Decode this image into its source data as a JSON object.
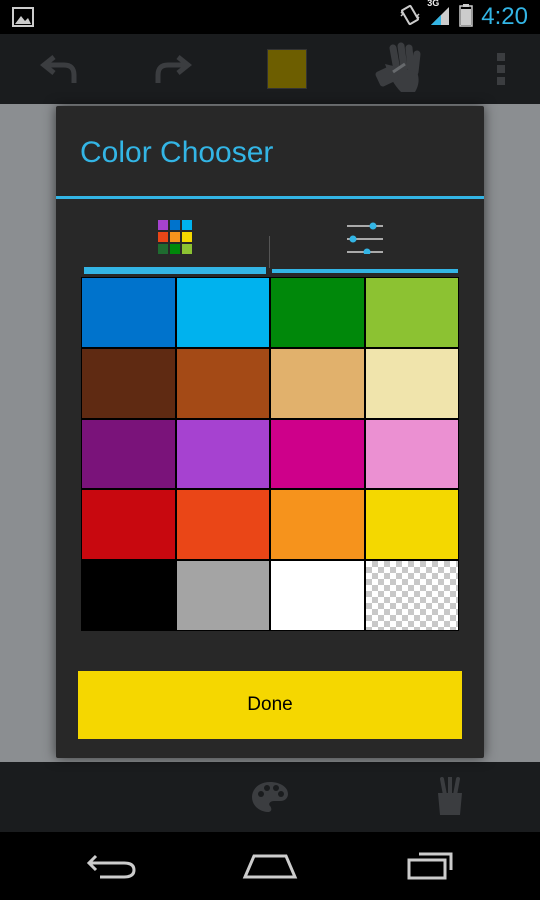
{
  "status_bar": {
    "time": "4:20",
    "network": "3G",
    "icons": [
      "gallery-icon",
      "vibrate-icon",
      "signal-icon",
      "battery-icon"
    ]
  },
  "action_bar": {
    "icons": [
      "undo-icon",
      "redo-icon",
      "current-color-icon",
      "paint-bucket-icon",
      "overflow-menu-icon"
    ],
    "current_color": "#6d5e00"
  },
  "dialog": {
    "title": "Color Chooser",
    "tabs": [
      {
        "icon": "palette-grid-icon",
        "active": true
      },
      {
        "icon": "sliders-icon",
        "active": false
      }
    ],
    "swatches": [
      {
        "color": "#0073cc"
      },
      {
        "color": "#00b2ee"
      },
      {
        "color": "#00880a"
      },
      {
        "color": "#8cc232"
      },
      {
        "color": "#5f2a12"
      },
      {
        "color": "#a44a16"
      },
      {
        "color": "#e1b16c"
      },
      {
        "color": "#f0e4ac"
      },
      {
        "color": "#7a137a"
      },
      {
        "color": "#a642d0"
      },
      {
        "color": "#ce008a"
      },
      {
        "color": "#eb90d2"
      },
      {
        "color": "#c8080f"
      },
      {
        "color": "#ea4617"
      },
      {
        "color": "#f6931c"
      },
      {
        "color": "#f4d800"
      },
      {
        "color": "#000000"
      },
      {
        "color": "#a4a4a4"
      },
      {
        "color": "#ffffff"
      },
      {
        "color": "transparent"
      }
    ],
    "done_label": "Done"
  },
  "bottom_toolbar": {
    "icons": [
      "palette-icon",
      "brushes-icon"
    ]
  },
  "nav_bar": {
    "icons": [
      "back-icon",
      "home-icon",
      "recent-apps-icon"
    ]
  },
  "colors": {
    "accent": "#33b5e5",
    "done_button": "#f5d700",
    "dialog_bg": "#282828",
    "bar_bg": "#1a1c1e",
    "canvas_bg": "#8b8e91"
  }
}
